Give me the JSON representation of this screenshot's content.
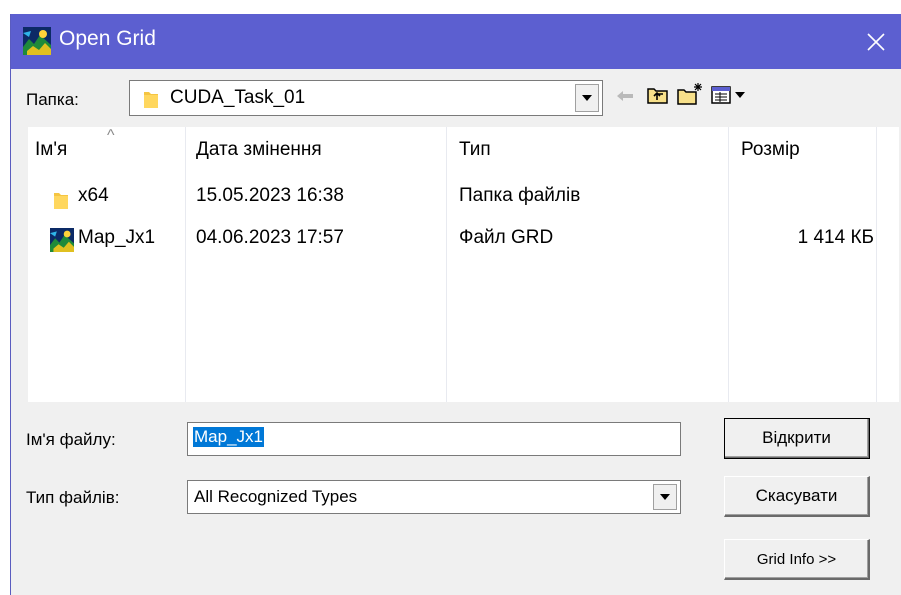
{
  "window": {
    "title": "Open Grid",
    "title_bar_color": "#5c5fd0",
    "icon": "grid-map-icon",
    "close_icon": "close-icon"
  },
  "folder_bar": {
    "label": "Папка:",
    "current_folder": "CUDA_Task_01",
    "folder_icon": "folder-icon",
    "toolbar_icons": [
      "back-arrow-icon",
      "up-one-level-icon",
      "new-folder-icon",
      "view-menu-icon"
    ]
  },
  "file_list": {
    "columns": [
      "Ім'я",
      "Дата змінення",
      "Тип",
      "Розмір"
    ],
    "sort_indicator": "^",
    "rows": [
      {
        "name": "x64",
        "icon": "folder-icon",
        "date": "15.05.2023 16:38",
        "type": "Папка файлів",
        "size": ""
      },
      {
        "name": "Map_Jx1",
        "icon": "grid-file-icon",
        "date": "04.06.2023 17:57",
        "type": "Файл GRD",
        "size": "1 414 КБ"
      }
    ]
  },
  "file_name": {
    "label": "Ім'я файлу:",
    "value": "Map_Jx1"
  },
  "file_type": {
    "label": "Тип файлів:",
    "value": "All Recognized Types"
  },
  "buttons": {
    "open": "Відкрити",
    "cancel": "Скасувати",
    "grid_info": "Grid Info >>"
  },
  "colors": {
    "selection": "#0078d7",
    "dialog_bg": "#f0f0f0"
  }
}
